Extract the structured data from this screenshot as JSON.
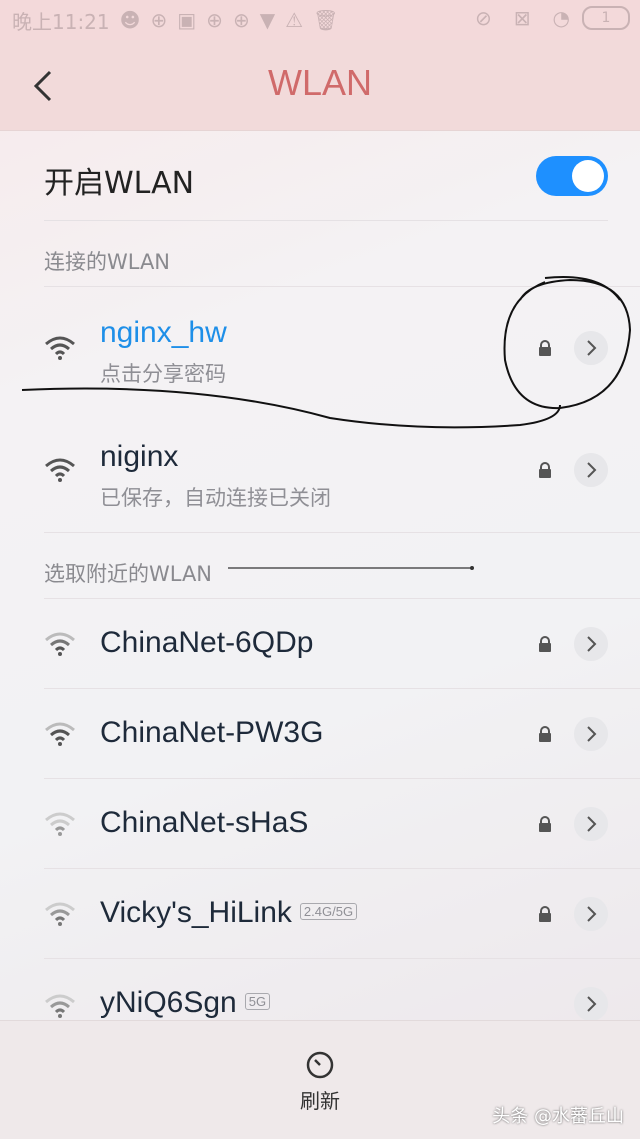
{
  "status": {
    "time": "晚上11:21",
    "battery": "1"
  },
  "header": {
    "title": "WLAN"
  },
  "toggle": {
    "label": "开启WLAN",
    "on": true
  },
  "sections": {
    "connected": "连接的WLAN",
    "nearby": "选取附近的WLAN"
  },
  "saved_networks": [
    {
      "name": "nginx_hw",
      "sub": "点击分享密码",
      "locked": true,
      "connected": true
    },
    {
      "name": "niginx",
      "sub": "已保存，自动连接已关闭",
      "locked": true,
      "connected": false
    }
  ],
  "nearby_networks": [
    {
      "name": "ChinaNet-6QDp",
      "badge": "",
      "locked": true
    },
    {
      "name": "ChinaNet-PW3G",
      "badge": "",
      "locked": true
    },
    {
      "name": "ChinaNet-sHaS",
      "badge": "",
      "locked": true
    },
    {
      "name": "Vicky's_HiLink",
      "badge": "2.4G/5G",
      "locked": true
    },
    {
      "name": "yNiQ6Sgn",
      "badge": "5G",
      "locked": false
    }
  ],
  "bottom": {
    "refresh_label": "刷新"
  },
  "watermark": "头条 @水蕃丘山",
  "colors": {
    "accent": "#1e8fe8",
    "title": "#d06a6a",
    "switch": "#1e90ff"
  }
}
